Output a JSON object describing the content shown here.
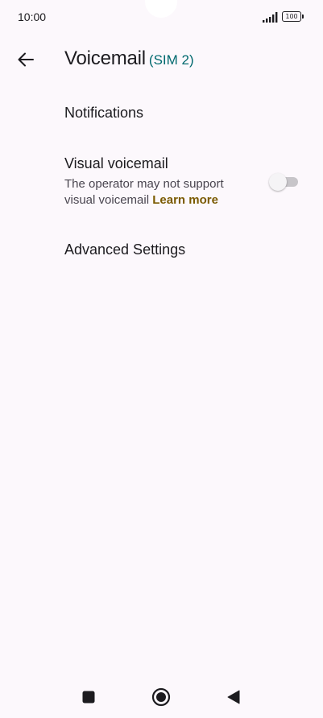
{
  "status_bar": {
    "time": "10:00",
    "battery": "100",
    "icons": [
      "signal-icon",
      "battery-icon"
    ]
  },
  "app_bar": {
    "back_icon": "arrow-back-icon",
    "title": "Voicemail",
    "subtitle": "(SIM 2)"
  },
  "preferences": [
    {
      "title": "Notifications"
    },
    {
      "title": "Visual voicemail",
      "summary": "The operator may not support visual voicemail",
      "link": "Learn more",
      "toggle_on": false
    },
    {
      "title": "Advanced Settings"
    }
  ],
  "nav_bar": {
    "icons": [
      "recents-square-icon",
      "home-circle-icon",
      "back-triangle-icon"
    ]
  },
  "colors": {
    "background": "#fcf8fc",
    "accent_teal": "#00696e",
    "link": "#7a5a00"
  }
}
